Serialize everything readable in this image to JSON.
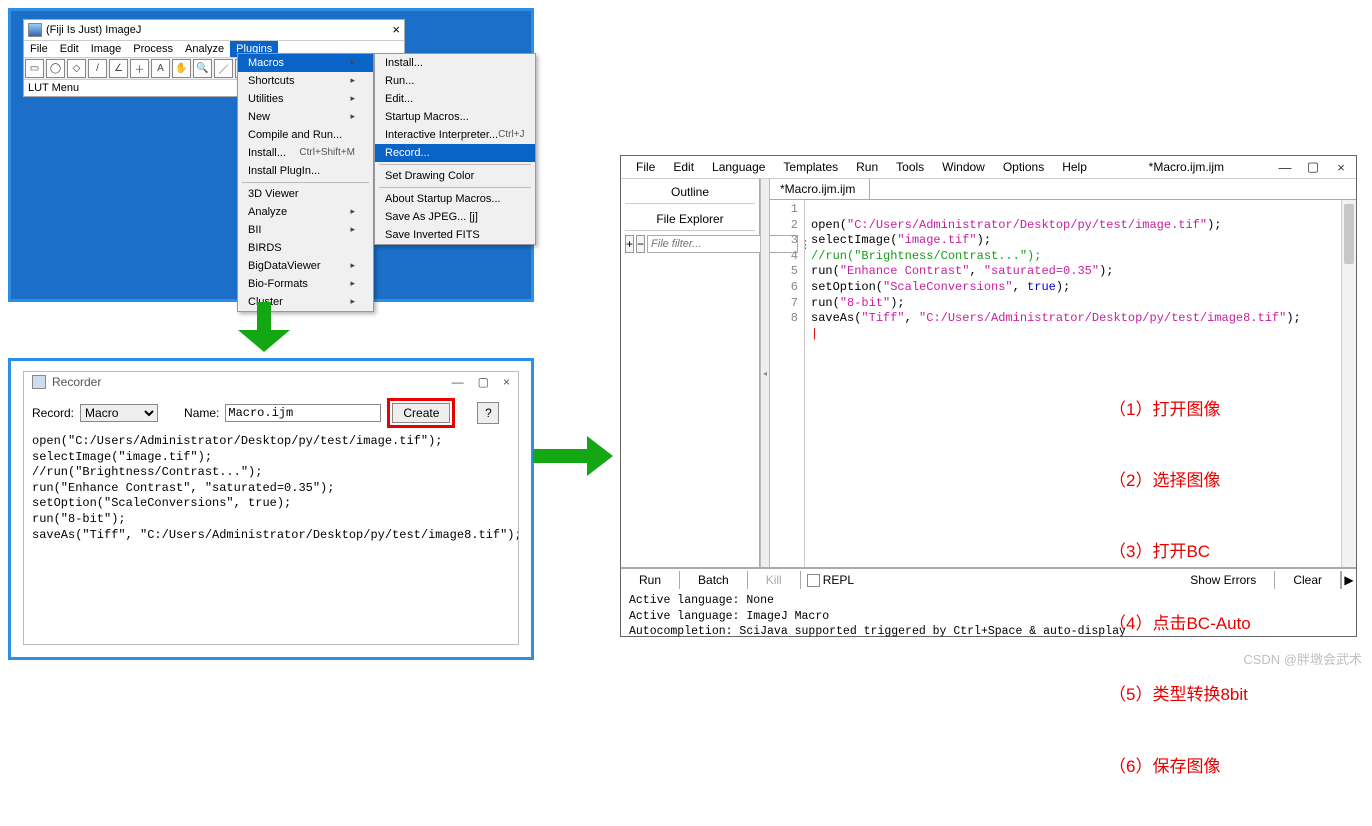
{
  "fiji": {
    "title": "(Fiji Is Just) ImageJ",
    "menubar": [
      "File",
      "Edit",
      "Image",
      "Process",
      "Analyze",
      "Plugins"
    ],
    "menubar_selected_index": 5,
    "lut_label": "LUT Menu",
    "tools": [
      "▭",
      "◯",
      "◇",
      "/",
      "∠",
      "＋",
      "A",
      "✋",
      "🔍",
      "／",
      "↗",
      "▦",
      "⌂",
      "»"
    ]
  },
  "plugins_menu": {
    "items": [
      {
        "label": "Macros",
        "arrow": true,
        "sel": true
      },
      {
        "label": "Shortcuts",
        "arrow": true
      },
      {
        "label": "Utilities",
        "arrow": true
      },
      {
        "label": "New",
        "arrow": true
      },
      {
        "label": "Compile and Run..."
      },
      {
        "label": "Install...",
        "shortcut": "Ctrl+Shift+M"
      },
      {
        "label": "Install PlugIn..."
      },
      {
        "sep": true
      },
      {
        "label": "3D Viewer"
      },
      {
        "label": "Analyze",
        "arrow": true
      },
      {
        "label": "BII",
        "arrow": true
      },
      {
        "label": "BIRDS"
      },
      {
        "label": "BigDataViewer",
        "arrow": true
      },
      {
        "label": "Bio-Formats",
        "arrow": true
      },
      {
        "label": "Cluster",
        "arrow": true
      }
    ]
  },
  "macros_menu": {
    "items": [
      {
        "label": "Install..."
      },
      {
        "label": "Run..."
      },
      {
        "label": "Edit..."
      },
      {
        "label": "Startup Macros..."
      },
      {
        "label": "Interactive Interpreter...",
        "shortcut": "Ctrl+J"
      },
      {
        "label": "Record...",
        "sel": true
      },
      {
        "sep": true
      },
      {
        "label": "Set Drawing Color"
      },
      {
        "sep": true
      },
      {
        "label": "About Startup Macros..."
      },
      {
        "label": "Save As JPEG... [j]"
      },
      {
        "label": "Save Inverted FITS"
      }
    ]
  },
  "recorder": {
    "title": "Recorder",
    "record_label": "Record:",
    "record_value": "Macro",
    "name_label": "Name:",
    "name_value": "Macro.ijm",
    "create_label": "Create",
    "help_label": "?",
    "code": "open(\"C:/Users/Administrator/Desktop/py/test/image.tif\");\nselectImage(\"image.tif\");\n//run(\"Brightness/Contrast...\");\nrun(\"Enhance Contrast\", \"saturated=0.35\");\nsetOption(\"ScaleConversions\", true);\nrun(\"8-bit\");\nsaveAs(\"Tiff\", \"C:/Users/Administrator/Desktop/py/test/image8.tif\");"
  },
  "editor": {
    "menubar": [
      "File",
      "Edit",
      "Language",
      "Templates",
      "Run",
      "Tools",
      "Window",
      "Options",
      "Help"
    ],
    "filename_title": "*Macro.ijm.ijm",
    "left": {
      "outline": "Outline",
      "file_explorer": "File Explorer",
      "plus": "+",
      "minus": "−",
      "filter_placeholder": "File filter...",
      "dots": "⋮"
    },
    "tab_label": "*Macro.ijm.ijm",
    "line_numbers": [
      "1",
      "2",
      "3",
      "4",
      "5",
      "6",
      "7",
      "8"
    ],
    "code": {
      "l1a": "open(",
      "l1b": "\"C:/Users/Administrator/Desktop/py/test/image.tif\"",
      "l1c": ");",
      "l2a": "selectImage(",
      "l2b": "\"image.tif\"",
      "l2c": ");",
      "l3": "//run(\"Brightness/Contrast...\");",
      "l4a": "run(",
      "l4b": "\"Enhance Contrast\"",
      "l4c": ", ",
      "l4d": "\"saturated=0.35\"",
      "l4e": ");",
      "l5a": "setOption(",
      "l5b": "\"ScaleConversions\"",
      "l5c": ", ",
      "l5d": "true",
      "l5e": ");",
      "l6a": "run(",
      "l6b": "\"8-bit\"",
      "l6c": ");",
      "l7a": "saveAs(",
      "l7b": "\"Tiff\"",
      "l7c": ", ",
      "l7d": "\"C:/Users/Administrator/Desktop/py/test/image8.tif\"",
      "l7e": ");"
    },
    "annotations": [
      "（1）打开图像",
      "（2）选择图像",
      "（3）打开BC",
      "（4）点击BC-Auto",
      "（5）类型转换8bit",
      "（6）保存图像"
    ],
    "toolbar2": {
      "run": "Run",
      "batch": "Batch",
      "kill": "Kill",
      "repl": "REPL",
      "show_errors": "Show Errors",
      "clear": "Clear",
      "tri": "▶"
    },
    "status": "Active language: None\nActive language: ImageJ Macro\nAutocompletion: SciJava supported triggered by Ctrl+Space & auto-display"
  },
  "watermark": "CSDN @胖墩会武术"
}
